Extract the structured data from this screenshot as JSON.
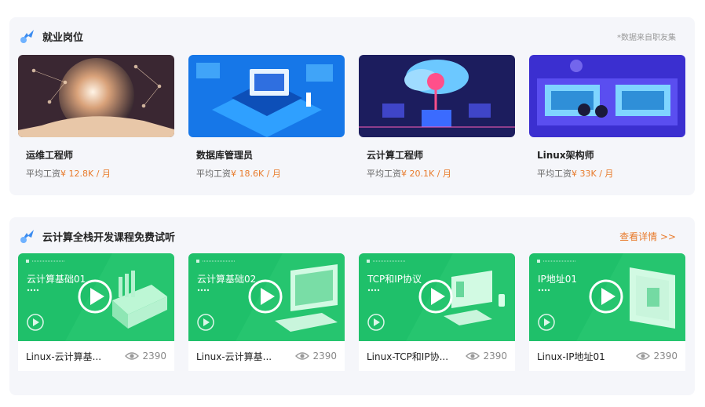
{
  "jobs": {
    "title": "就业岗位",
    "note": "*数据来自职友集",
    "salary_prefix": "平均工资",
    "items": [
      {
        "title": "运维工程师",
        "salary": "¥ 12.8K / 月"
      },
      {
        "title": "数据库管理员",
        "salary": "¥ 18.6K / 月"
      },
      {
        "title": "云计算工程师",
        "salary": "¥ 20.1K / 月"
      },
      {
        "title": "Linux架构师",
        "salary": "¥ 33K / 月"
      }
    ]
  },
  "courses": {
    "title": "云计算全栈开发课程免费试听",
    "more_link": "查看详情 >>",
    "items": [
      {
        "category": "云计算基础01",
        "name": "Linux-云计算基...",
        "views": "2390"
      },
      {
        "category": "云计算基础02",
        "name": "Linux-云计算基...",
        "views": "2390"
      },
      {
        "category": "TCP和IP协议",
        "name": "Linux-TCP和IP协...",
        "views": "2390"
      },
      {
        "category": "IP地址01",
        "name": "Linux-IP地址01",
        "views": "2390"
      }
    ]
  },
  "colors": {
    "accent": "#e87a2b",
    "course_green": "#1fc06a",
    "panel_bg": "#f5f6fa"
  }
}
